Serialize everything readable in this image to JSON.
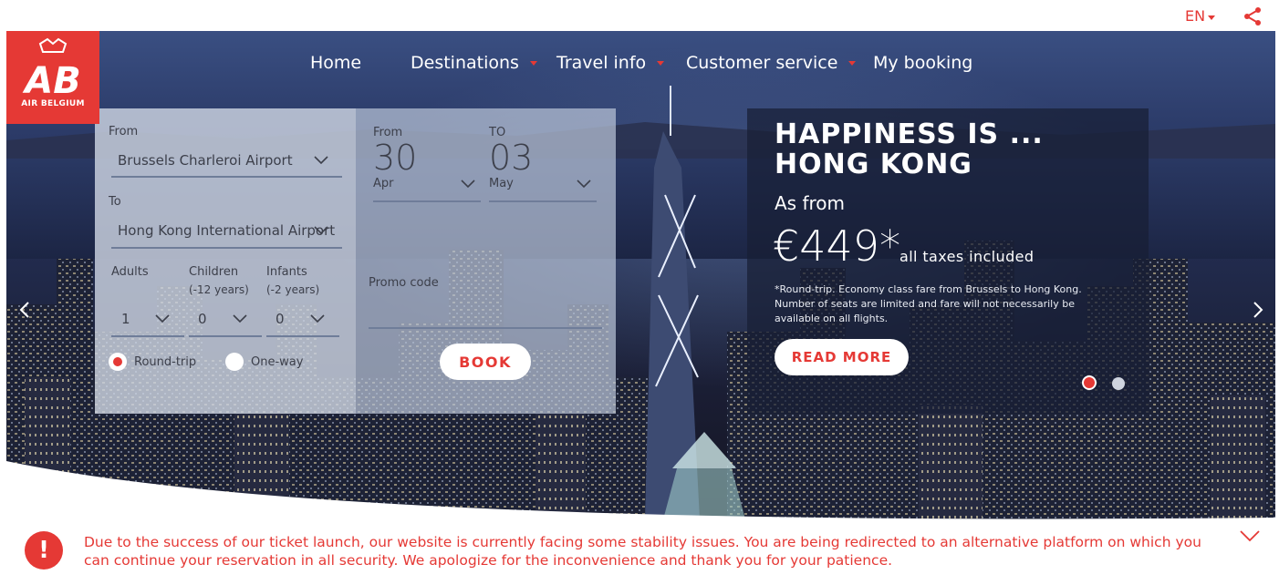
{
  "topbar": {
    "language": "EN"
  },
  "logo": {
    "brand_text": "AIR BELGIUM",
    "monogram": "AB"
  },
  "nav": {
    "items": [
      {
        "label": "Home",
        "has_dropdown": false
      },
      {
        "label": "Destinations",
        "has_dropdown": true
      },
      {
        "label": "Travel info",
        "has_dropdown": true
      },
      {
        "label": "Customer service",
        "has_dropdown": true
      },
      {
        "label": "My booking",
        "has_dropdown": false
      }
    ]
  },
  "booking": {
    "from_label": "From",
    "from_value": "Brussels Charleroi Airport",
    "to_label": "To",
    "to_value": "Hong Kong International Airport",
    "adults_label": "Adults",
    "adults_value": "1",
    "children_label": "Children",
    "children_sub": "(-12 years)",
    "children_value": "0",
    "infants_label": "Infants",
    "infants_sub": "(-2 years)",
    "infants_value": "0",
    "roundtrip_label": "Round-trip",
    "oneway_label": "One-way",
    "trip_type_selected": "Round-trip",
    "date_from_label": "From",
    "date_from_day": "30",
    "date_from_month": "Apr",
    "date_to_label": "TO",
    "date_to_day": "03",
    "date_to_month": "May",
    "promo_label": "Promo code",
    "promo_value": "",
    "book_label": "BOOK"
  },
  "promo": {
    "title": "HAPPINESS IS ... HONG KONG",
    "as_from": "As from",
    "price": "€449*",
    "taxes": "all taxes included",
    "note": "*Round-trip. Economy class fare from Brussels to Hong Kong. Number of seats are limited and fare will not necessarily be available on all flights.",
    "read_more": "READ MORE"
  },
  "carousel": {
    "slides": 2,
    "active": 1
  },
  "notice": {
    "icon": "!",
    "text": "Due to the success of our ticket launch, our website is currently facing some stability issues. You are being redirected to an alternative platform on which you can continue your reservation in all security. We apologize for the inconvenience and thank you for your patience."
  },
  "colors": {
    "accent": "#e53935",
    "white": "#ffffff",
    "form_text": "#3c3f4a"
  },
  "icons": {
    "share": "share-icon",
    "chevron": "chevron-down-icon",
    "prev": "chevron-left-icon",
    "next": "chevron-right-icon",
    "alert": "alert-icon"
  }
}
